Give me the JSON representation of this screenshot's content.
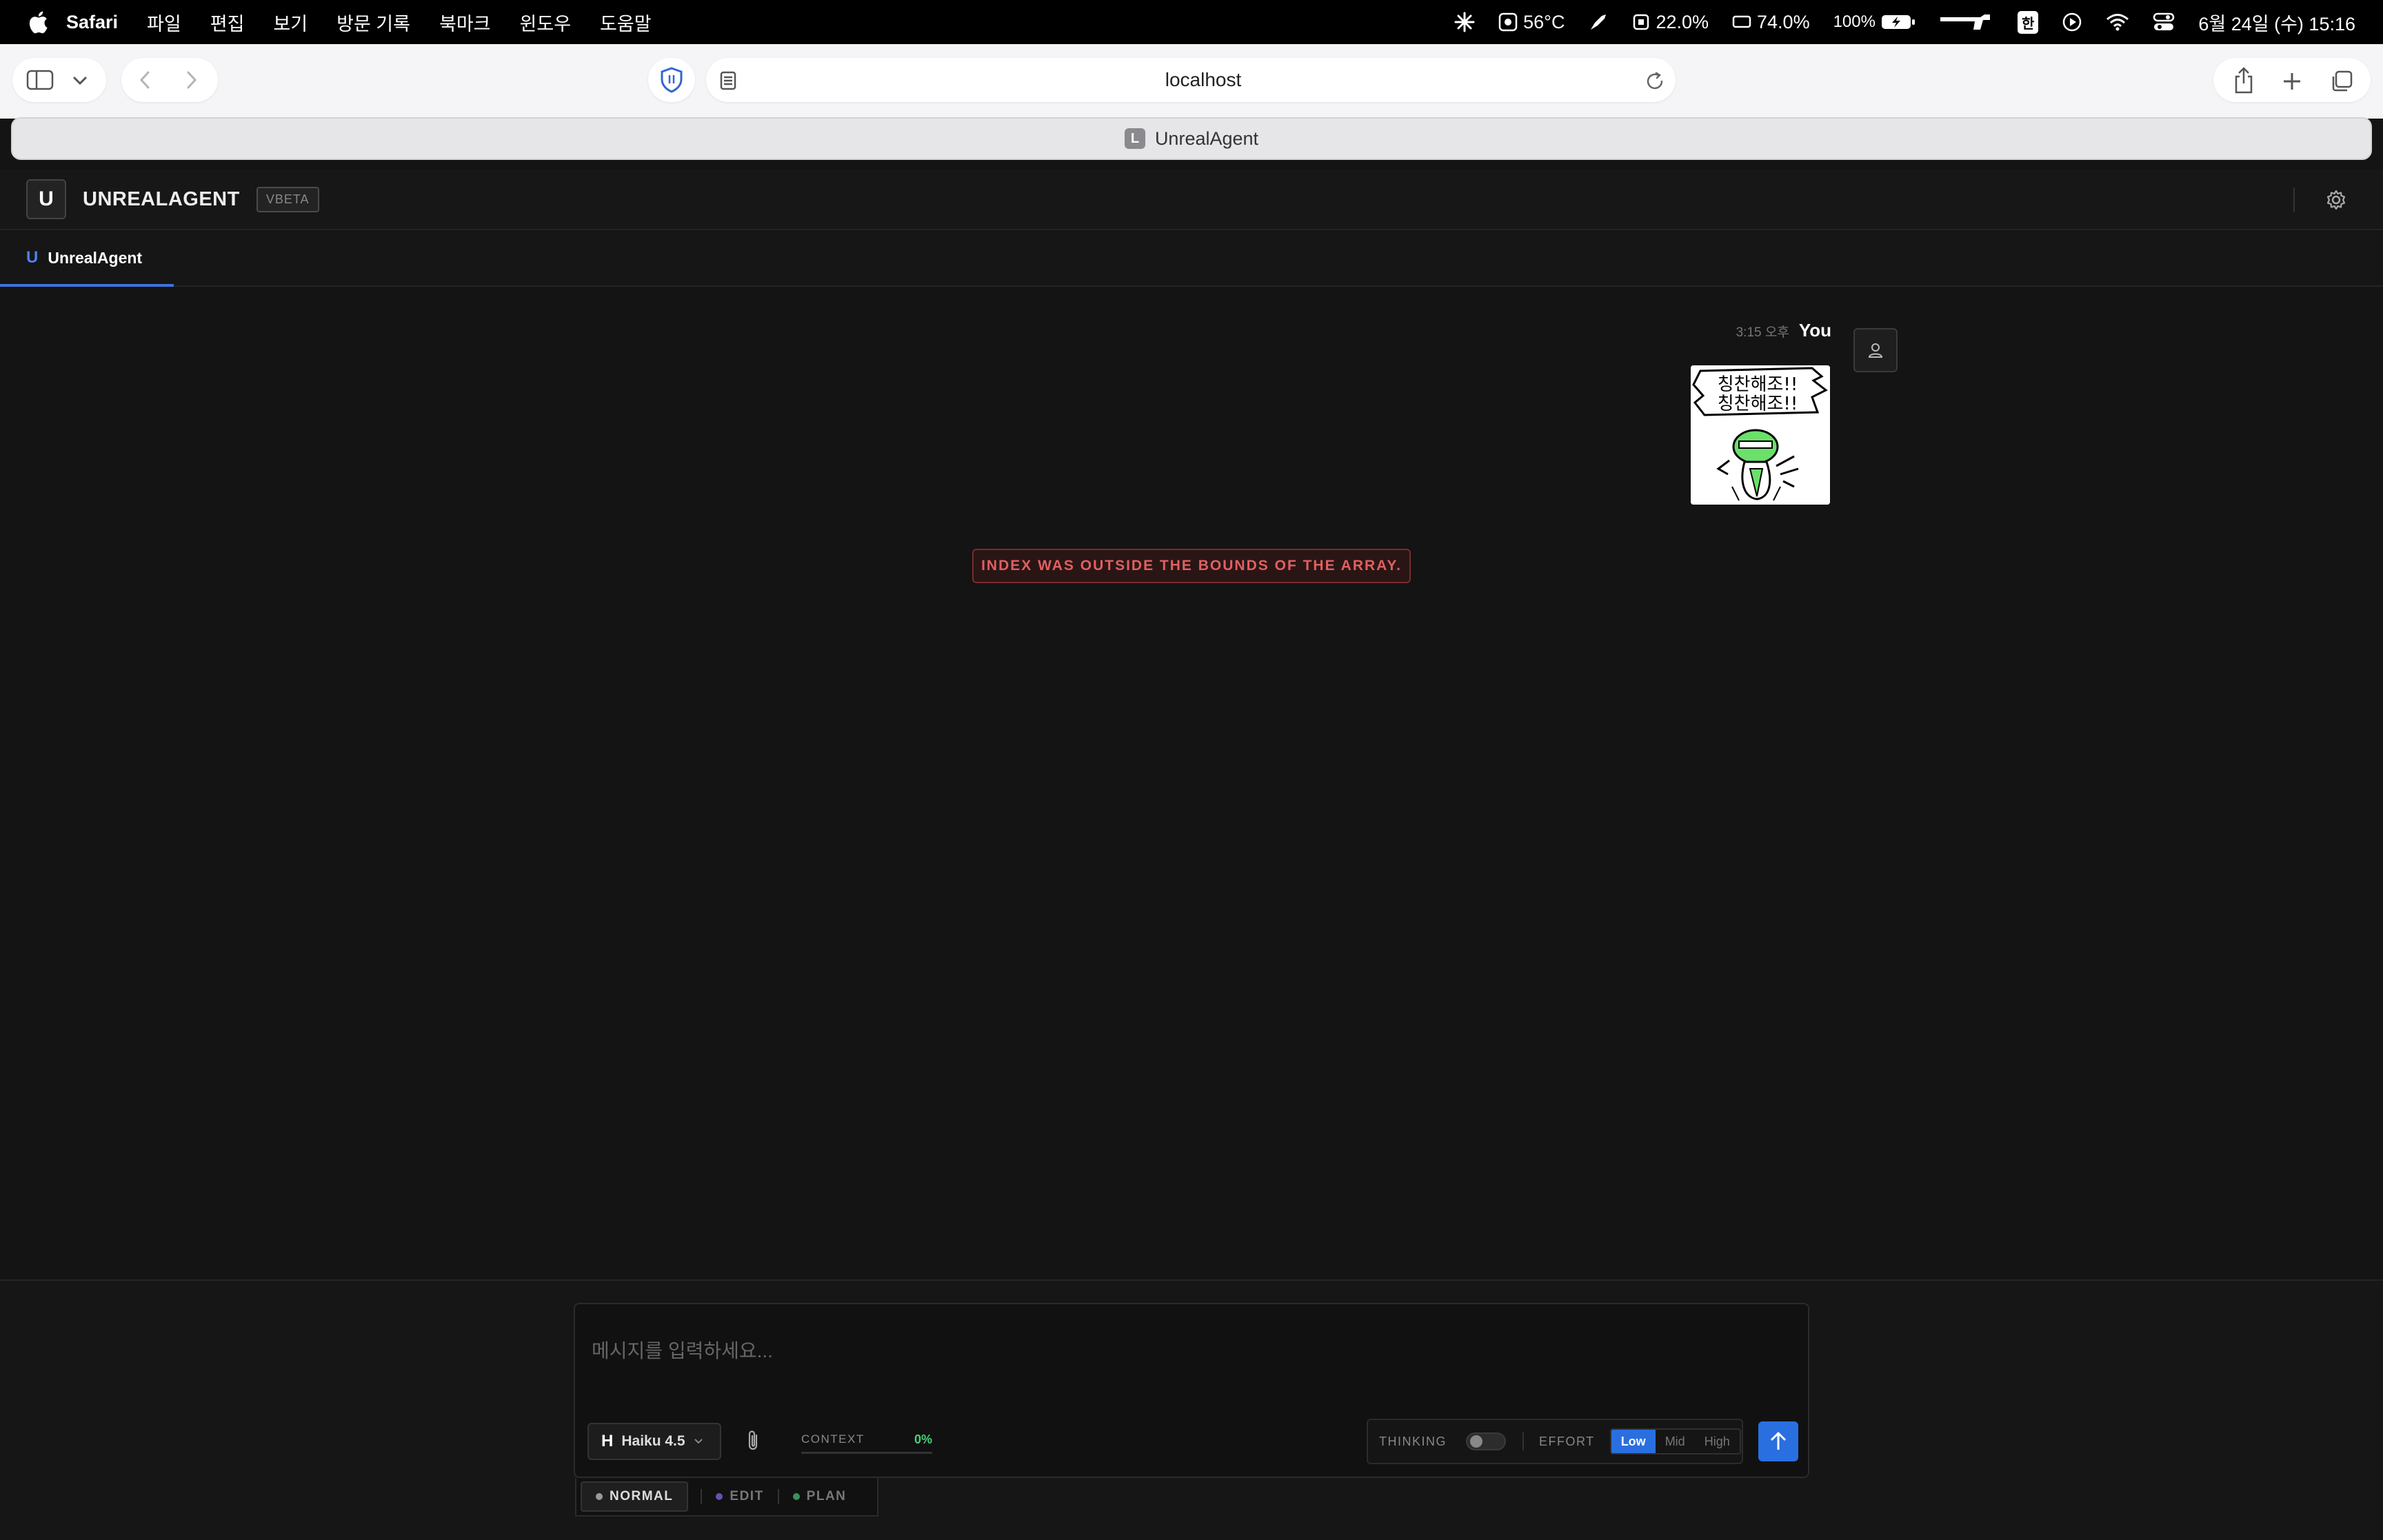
{
  "menubar": {
    "app": "Safari",
    "items": [
      "파일",
      "편집",
      "보기",
      "방문 기록",
      "북마크",
      "윈도우",
      "도움말"
    ],
    "temperature": "56°C",
    "cpu": "22.0%",
    "memory": "74.0%",
    "battery": "100%",
    "input_method": "한",
    "datetime": "6월 24일 (수) 15:16"
  },
  "browser": {
    "address": "localhost",
    "tab_favicon": "L",
    "tab_title": "UnrealAgent"
  },
  "app": {
    "logo": "U",
    "name": "UNREALAGENT",
    "version_badge": "VBETA",
    "tab": {
      "icon": "U",
      "label": "UnrealAgent"
    }
  },
  "chat": {
    "message": {
      "time": "3:15 오후",
      "author": "You",
      "image_text": [
        "칭찬해조!!",
        "칭찬해조!!"
      ]
    },
    "error": "INDEX WAS OUTSIDE THE BOUNDS OF THE ARRAY."
  },
  "composer": {
    "placeholder": "메시지를 입력하세요...",
    "model_initial": "H",
    "model": "Haiku 4.5",
    "context_label": "CONTEXT",
    "context_pct": "0%",
    "thinking_label": "THINKING",
    "effort_label": "EFFORT",
    "effort_options": [
      "Low",
      "Mid",
      "High"
    ],
    "effort_selected": "Low",
    "modes": [
      {
        "label": "NORMAL",
        "color": "#9a9a9a"
      },
      {
        "label": "EDIT",
        "color": "#6a4fb0"
      },
      {
        "label": "PLAN",
        "color": "#3f8f5a"
      }
    ],
    "active_mode": "NORMAL"
  },
  "colors": {
    "accent": "#2a6fe0",
    "error": "#e06060",
    "context_ok": "#4cd07a"
  }
}
